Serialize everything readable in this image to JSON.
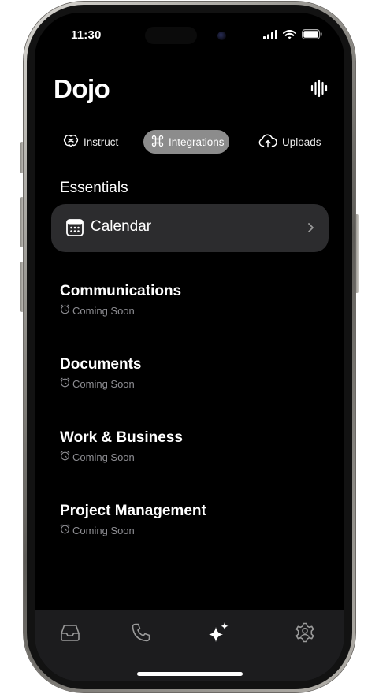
{
  "status_bar": {
    "time": "11:30",
    "icons": [
      "signal-icon",
      "wifi-icon",
      "battery-icon"
    ]
  },
  "header": {
    "title": "Dojo",
    "voice_icon": "waveform-icon"
  },
  "tabs": [
    {
      "label": "Instruct",
      "icon": "brain-icon",
      "active": false
    },
    {
      "label": "Integrations",
      "icon": "command-icon",
      "active": true
    },
    {
      "label": "Uploads",
      "icon": "cloud-upload-icon",
      "active": false
    }
  ],
  "essentials": {
    "title": "Essentials",
    "items": [
      {
        "label": "Calendar",
        "icon": "calendar-icon",
        "chevron": "chevron-right-icon"
      }
    ]
  },
  "groups": [
    {
      "title": "Communications",
      "status": "Coming Soon"
    },
    {
      "title": "Documents",
      "status": "Coming Soon"
    },
    {
      "title": "Work & Business",
      "status": "Coming Soon"
    },
    {
      "title": "Project Management",
      "status": "Coming Soon"
    }
  ],
  "bottom_nav": [
    {
      "name": "inbox-icon"
    },
    {
      "name": "phone-icon"
    },
    {
      "name": "sparkles-icon"
    },
    {
      "name": "settings-icon"
    }
  ],
  "colors": {
    "background": "#000000",
    "card": "#2c2c2e",
    "active_tab": "#8c8c8c",
    "muted_text": "#8e8e93",
    "bottom_bar": "#1c1c1e"
  }
}
